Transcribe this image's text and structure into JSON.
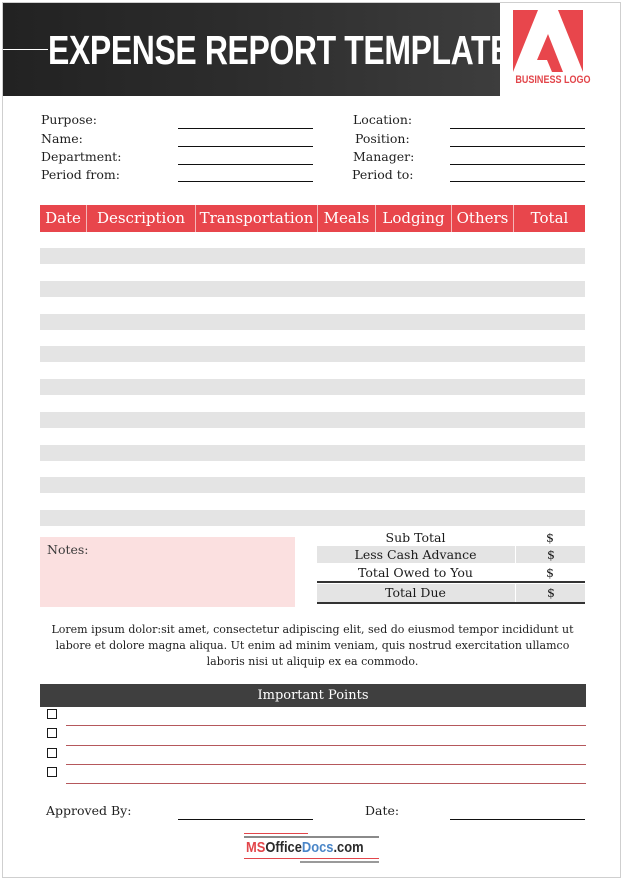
{
  "header": {
    "title": "EXPENSE REPORT TEMPLATE",
    "logo_icon": "adobe-style-a-logo-icon",
    "logo_text": "BUSINESS LOGO"
  },
  "info_fields": {
    "left": [
      {
        "label": "Purpose:",
        "value": ""
      },
      {
        "label": "Name:",
        "value": ""
      },
      {
        "label": "Department:",
        "value": ""
      },
      {
        "label": "Period from:",
        "value": ""
      }
    ],
    "right": [
      {
        "label": "Location:",
        "value": ""
      },
      {
        "label": "Position:",
        "value": ""
      },
      {
        "label": "Manager:",
        "value": ""
      },
      {
        "label": "Period to:",
        "value": ""
      }
    ]
  },
  "expense_table": {
    "columns": [
      "Date",
      "Description",
      "Transportation",
      "Meals",
      "Lodging",
      "Others",
      "Total"
    ],
    "row_count": 9,
    "rows": []
  },
  "notes": {
    "label": "Notes:",
    "value": ""
  },
  "summary": [
    {
      "label": "Sub Total",
      "value": "$"
    },
    {
      "label": "Less Cash Advance",
      "value": "$"
    },
    {
      "label": "Total Owed to You",
      "value": "$"
    },
    {
      "label": "Total Due",
      "value": "$"
    }
  ],
  "body_text": "Lorem ipsum dolor:sit amet, consectetur adipiscing elit, sed do eiusmod tempor incididunt ut labore et dolore magna aliqua. Ut enim ad minim veniam, quis nostrud exercitation ullamco laboris nisi ut aliquip ex ea commodo.",
  "important_points": {
    "title": "Important Points",
    "items": [
      "",
      "",
      "",
      ""
    ]
  },
  "footer": {
    "approved_by_label": "Approved By:",
    "date_label": "Date:"
  },
  "brand": {
    "ms": "MS",
    "office": "Office",
    "docs": "Docs",
    "com": ".com"
  },
  "colors": {
    "accent_red": "#e8464c",
    "header_dark": "#2c2c2c",
    "stripe_gray": "#e4e4e4",
    "notes_pink": "#fbe0e0",
    "important_bar": "#3f3f3f"
  }
}
